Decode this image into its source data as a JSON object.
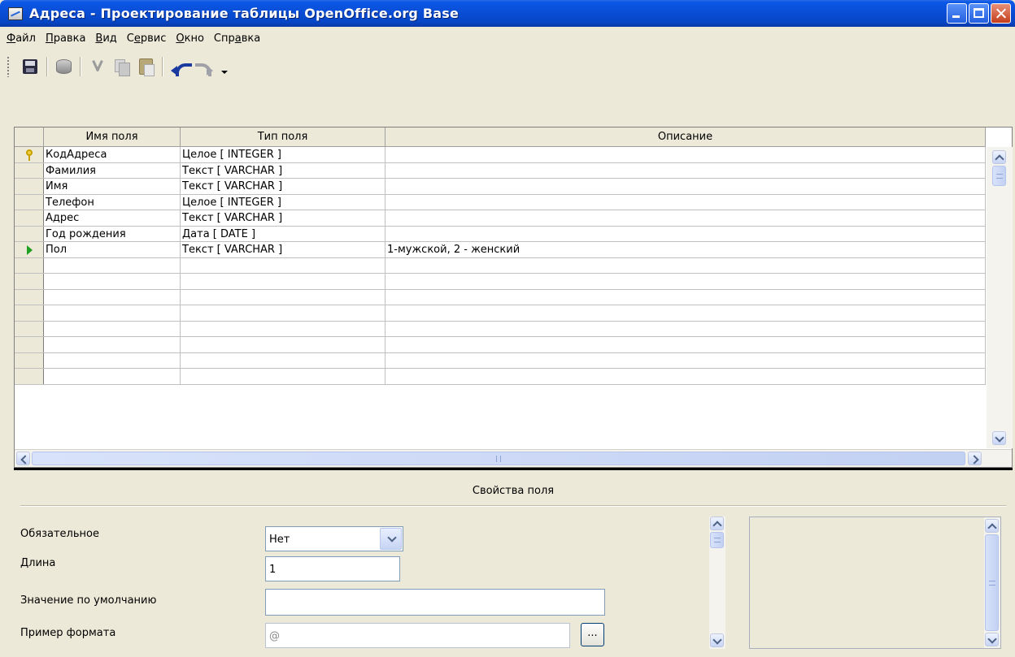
{
  "window": {
    "title": "Адреса - Проектирование таблицы OpenOffice.org Base"
  },
  "menu": [
    {
      "pre": "",
      "ul": "Ф",
      "post": "айл"
    },
    {
      "pre": "",
      "ul": "П",
      "post": "равка"
    },
    {
      "pre": "",
      "ul": "В",
      "post": "ид"
    },
    {
      "pre": "С",
      "ul": "е",
      "post": "рвис"
    },
    {
      "pre": "",
      "ul": "О",
      "post": "кно"
    },
    {
      "pre": "Спр",
      "ul": "а",
      "post": "вка"
    }
  ],
  "toolbar": {
    "icons": [
      "save-icon",
      "database-icon",
      "cut-icon",
      "copy-icon",
      "paste-icon",
      "undo-icon",
      "redo-icon"
    ]
  },
  "grid": {
    "columns": [
      "Имя поля",
      "Тип поля",
      "Описание"
    ],
    "rows": [
      {
        "marker": "key",
        "name": "КодАдреса",
        "type": "Целое [ INTEGER ]",
        "desc": ""
      },
      {
        "marker": "",
        "name": "Фамилия",
        "type": "Текст [ VARCHAR ]",
        "desc": ""
      },
      {
        "marker": "",
        "name": "Имя",
        "type": "Текст [ VARCHAR ]",
        "desc": ""
      },
      {
        "marker": "",
        "name": "Телефон",
        "type": "Целое [ INTEGER ]",
        "desc": ""
      },
      {
        "marker": "",
        "name": "Адрес",
        "type": "Текст [ VARCHAR ]",
        "desc": ""
      },
      {
        "marker": "",
        "name": "Год рождения",
        "type": "Дата [ DATE ]",
        "desc": ""
      },
      {
        "marker": "current",
        "name": "Пол",
        "type": "Текст [ VARCHAR ]",
        "desc": "1-мужской, 2 - женский"
      },
      {
        "marker": "",
        "name": "",
        "type": "",
        "desc": ""
      },
      {
        "marker": "",
        "name": "",
        "type": "",
        "desc": ""
      },
      {
        "marker": "",
        "name": "",
        "type": "",
        "desc": ""
      },
      {
        "marker": "",
        "name": "",
        "type": "",
        "desc": ""
      },
      {
        "marker": "",
        "name": "",
        "type": "",
        "desc": ""
      },
      {
        "marker": "",
        "name": "",
        "type": "",
        "desc": ""
      },
      {
        "marker": "",
        "name": "",
        "type": "",
        "desc": ""
      },
      {
        "marker": "",
        "name": "",
        "type": "",
        "desc": ""
      }
    ]
  },
  "properties": {
    "title": "Свойства поля",
    "required_label": "Обязательное",
    "required_value": "Нет",
    "length_label": "Длина",
    "length_value": "1",
    "default_label": "Значение по умолчанию",
    "default_value": "",
    "format_label": "Пример формата",
    "format_value": "@",
    "format_button": "..."
  }
}
